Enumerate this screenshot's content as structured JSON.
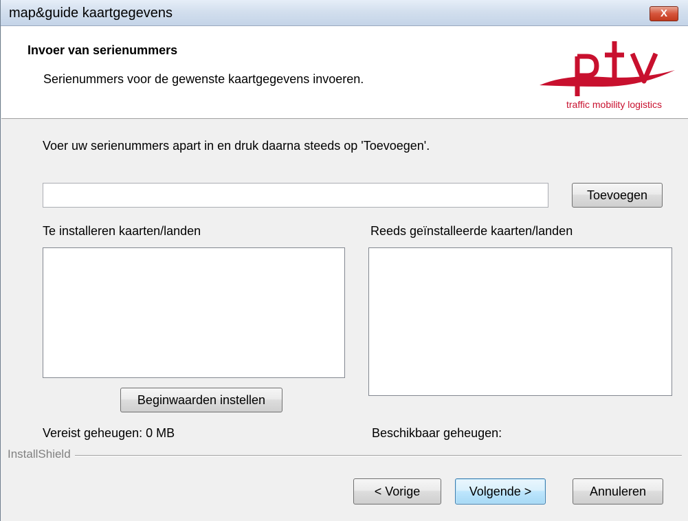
{
  "window": {
    "title": "map&guide kaartgegevens",
    "close_label": "X"
  },
  "header": {
    "title": "Invoer van serienummers",
    "subtitle": "Serienummers voor de gewenste kaartgegevens invoeren.",
    "logo_text": "ptv",
    "logo_tagline": "traffic mobility logistics",
    "brand_color": "#c8102e"
  },
  "main": {
    "instruction": "Voer uw serienummers apart in en druk daarna steeds op 'Toevoegen'.",
    "serial_input": {
      "value": "",
      "placeholder": ""
    },
    "add_button": "Toevoegen",
    "left_list_label": "Te installeren kaarten/landen",
    "right_list_label": "Reeds geïnstalleerde kaarten/landen",
    "left_list_items": [],
    "right_list_items": [],
    "reset_button": "Beginwaarden instellen",
    "required_memory": "Vereist geheugen: 0 MB",
    "available_memory": "Beschikbaar geheugen:"
  },
  "footer": {
    "brand": "InstallShield",
    "back_button": "< Vorige",
    "next_button": "Volgende >",
    "cancel_button": "Annuleren"
  }
}
